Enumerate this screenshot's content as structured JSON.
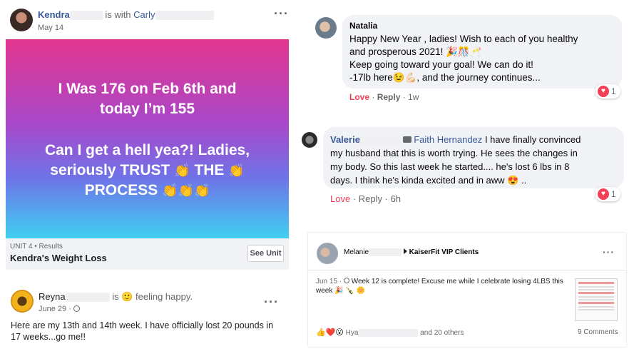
{
  "post1": {
    "author": "Kendra",
    "with_text": "is with",
    "tagged": "Carly",
    "date": "May 14",
    "card_line1": "I Was 176 on Feb 6th and",
    "card_line2": "today I’m 155",
    "card_line3": "Can I get a hell yea?! Ladies,",
    "card_line4a": "seriously TRUST",
    "card_line4b": "THE",
    "card_line5": "PROCESS",
    "clap_emoji": "👏",
    "gradient_top": "#e3368f",
    "gradient_bottom": "#3fd0f0",
    "unit_meta": "UNIT 4 • Results",
    "unit_title": "Kendra's Weight Loss",
    "see_unit": "See Unit"
  },
  "post2": {
    "author": "Reyna",
    "status": "is 🙂 feeling happy.",
    "date": "June 29 · ",
    "text": "Here are my 13th and 14th week. I have officially lost 20 pounds in 17 weeks...go me!!"
  },
  "comment1": {
    "author": "Natalia",
    "line1": "Happy New Year , ladies! Wish to each of you healthy",
    "line2": "and prosperous 2021! 🎉🎊🥂",
    "line3": "Keep going toward your goal! We can do it!",
    "line4": "-17lb here😉💪🏻, and the journey continues...",
    "love": "Love",
    "sep": " · ",
    "reply": "Reply",
    "age": "1w",
    "reaction_count": "1"
  },
  "comment2": {
    "author": "Valerie",
    "mention": "Faith Hernandez",
    "line1": "I have finally convinced",
    "line2": "my husband that this is worth trying. He sees the changes in",
    "line3": "my body. So this last week he started.... he's lost 6 lbs in 8",
    "line4": "days. I think he's kinda excited and in aww 😍 ..",
    "love": "Love",
    "sep": " · ",
    "reply": "Reply",
    "age": "6h",
    "reaction_count": "1"
  },
  "post3": {
    "author": "Melanie",
    "group": "KaiserFit VIP Clients",
    "date": "Jun 15 · ",
    "text_line1": "Week 12 is complete! Excuse me while I celebrate losing 4LBS this",
    "text_line2": "week 🎉 🍾 🌼",
    "reactor": "Hya",
    "others": "and 20 others",
    "comments": "9 Comments",
    "reaction_icons": "👍❤️😮"
  }
}
